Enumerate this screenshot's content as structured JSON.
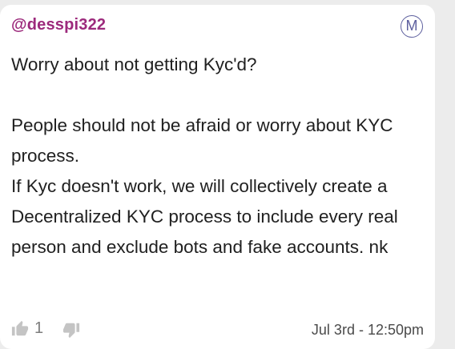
{
  "post": {
    "username": "@desspi322",
    "badge_letter": "M",
    "body": "Worry about not getting Kyc'd?\n\nPeople should not be afraid or worry about KYC process.\nIf Kyc doesn't work, we will collectively create a Decentralized KYC process to include every real person and exclude bots and fake accounts. nk",
    "like_count": "1",
    "timestamp": "Jul 3rd - 12:50pm"
  },
  "colors": {
    "username": "#9c2a7c",
    "badge": "#5d5f9e",
    "text": "#202020",
    "muted_icon": "#c4c4c4"
  },
  "icons": {
    "like": "thumbs-up-icon",
    "dislike": "thumbs-down-icon"
  }
}
